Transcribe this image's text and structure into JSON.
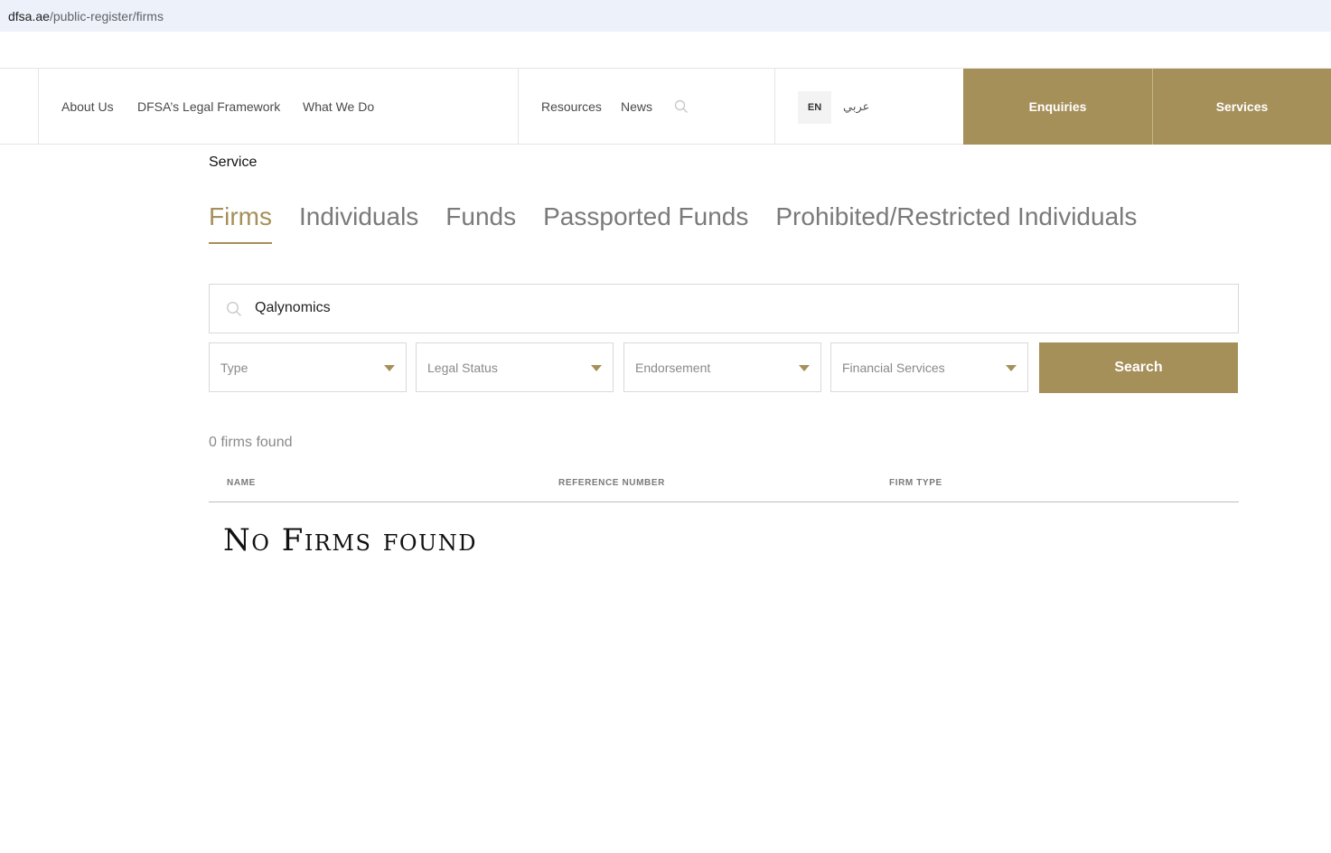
{
  "browser": {
    "url_domain": "dfsa.ae",
    "url_path": "/public-register/firms"
  },
  "header": {
    "nav_left": [
      "About Us",
      "DFSA’s Legal Framework",
      "What We Do"
    ],
    "nav_right": [
      "Resources",
      "News"
    ],
    "lang_en": "EN",
    "lang_ar": "عربي",
    "enquiries": "Enquiries",
    "services": "Services"
  },
  "breadcrumb": "Service",
  "tabs": [
    {
      "label": "Firms",
      "active": true
    },
    {
      "label": "Individuals",
      "active": false
    },
    {
      "label": "Funds",
      "active": false
    },
    {
      "label": "Passported Funds",
      "active": false
    },
    {
      "label": "Prohibited/Restricted Individuals",
      "active": false
    }
  ],
  "search": {
    "value": "Qalynomics"
  },
  "filters": [
    "Type",
    "Legal Status",
    "Endorsement",
    "Financial Services"
  ],
  "search_button": "Search",
  "results": {
    "count_text": "0 firms found",
    "columns": [
      "NAME",
      "REFERENCE NUMBER",
      "FIRM TYPE"
    ],
    "empty_text": "No Firms found"
  },
  "colors": {
    "accent": "#a69059"
  }
}
